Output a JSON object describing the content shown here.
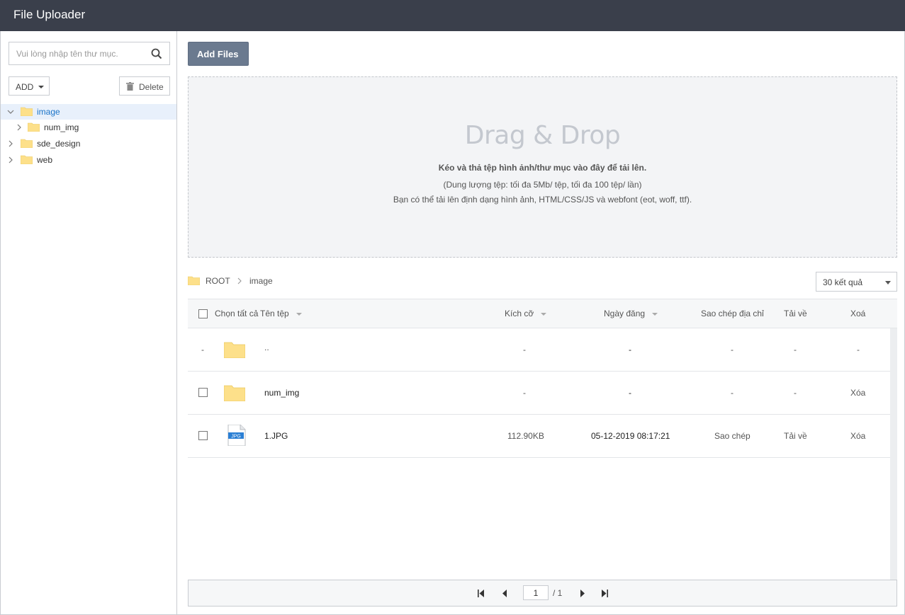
{
  "app": {
    "title": "File Uploader"
  },
  "sidebar": {
    "search_placeholder": "Vui lòng nhập tên thư mục.",
    "add_label": "ADD",
    "delete_label": "Delete",
    "tree": [
      {
        "name": "image",
        "expanded": true,
        "selected": true,
        "depth": 0
      },
      {
        "name": "num_img",
        "expanded": false,
        "selected": false,
        "depth": 1
      },
      {
        "name": "sde_design",
        "expanded": false,
        "selected": false,
        "depth": 0
      },
      {
        "name": "web",
        "expanded": false,
        "selected": false,
        "depth": 0
      }
    ]
  },
  "toolbar": {
    "add_files_label": "Add Files"
  },
  "dropzone": {
    "title": "Drag & Drop",
    "line1": "Kéo và thả tệp hình ảnh/thư mục vào đây để tải lên.",
    "line2": "(Dung lượng tệp: tối đa 5Mb/ tệp, tối đa 100 tệp/ lần)",
    "line3": "Bạn có thể tải lên định dạng hình ảnh, HTML/CSS/JS và webfont (eot, woff, ttf)."
  },
  "breadcrumb": {
    "root": "ROOT",
    "current": "image"
  },
  "per_page": {
    "selected": "30 kết quả"
  },
  "table": {
    "headers": {
      "select_all": "Chọn tất cả",
      "name": "Tên tệp",
      "size": "Kích cỡ",
      "date": "Ngày đăng",
      "copy": "Sao chép địa chỉ",
      "download": "Tải về",
      "delete": "Xoá"
    },
    "rows": [
      {
        "check": "-",
        "type": "folder",
        "name": "..",
        "size": "-",
        "date": "-",
        "copy": "-",
        "download": "-",
        "delete": "-"
      },
      {
        "check": "box",
        "type": "folder",
        "name": "num_img",
        "size": "-",
        "date": "-",
        "copy": "-",
        "download": "-",
        "delete": "Xóa"
      },
      {
        "check": "box",
        "type": "jpg",
        "icon_label": "JPG",
        "name": "1.JPG",
        "size": "112.90KB",
        "date": "05-12-2019 08:17:21",
        "copy": "Sao chép",
        "download": "Tải về",
        "delete": "Xóa"
      }
    ]
  },
  "pagination": {
    "current": "1",
    "total": "/ 1"
  },
  "colors": {
    "titlebar": "#3a3f4b",
    "accent": "#1a73c8",
    "add_files_bg": "#6b7a8f",
    "folder": "#fde08a"
  }
}
